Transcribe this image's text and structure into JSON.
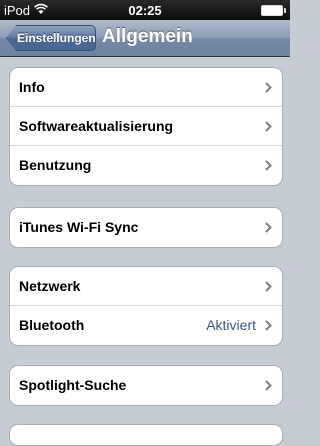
{
  "status_bar": {
    "carrier": "iPod",
    "time": "02:25",
    "wifi_icon": "wifi-icon",
    "battery_icon": "battery-icon"
  },
  "nav": {
    "back_label": "Einstellungen",
    "title": "Allgemein"
  },
  "groups": [
    {
      "rows": [
        {
          "label": "Info",
          "value": ""
        },
        {
          "label": "Softwareaktualisierung",
          "value": ""
        },
        {
          "label": "Benutzung",
          "value": ""
        }
      ]
    },
    {
      "rows": [
        {
          "label": "iTunes Wi-Fi Sync",
          "value": ""
        }
      ]
    },
    {
      "rows": [
        {
          "label": "Netzwerk",
          "value": ""
        },
        {
          "label": "Bluetooth",
          "value": "Aktiviert"
        }
      ]
    },
    {
      "rows": [
        {
          "label": "Spotlight-Suche",
          "value": ""
        }
      ]
    }
  ],
  "colors": {
    "background": "#c5ccd4",
    "accent_value": "#385487",
    "nav_bar": "#6d84a2"
  }
}
